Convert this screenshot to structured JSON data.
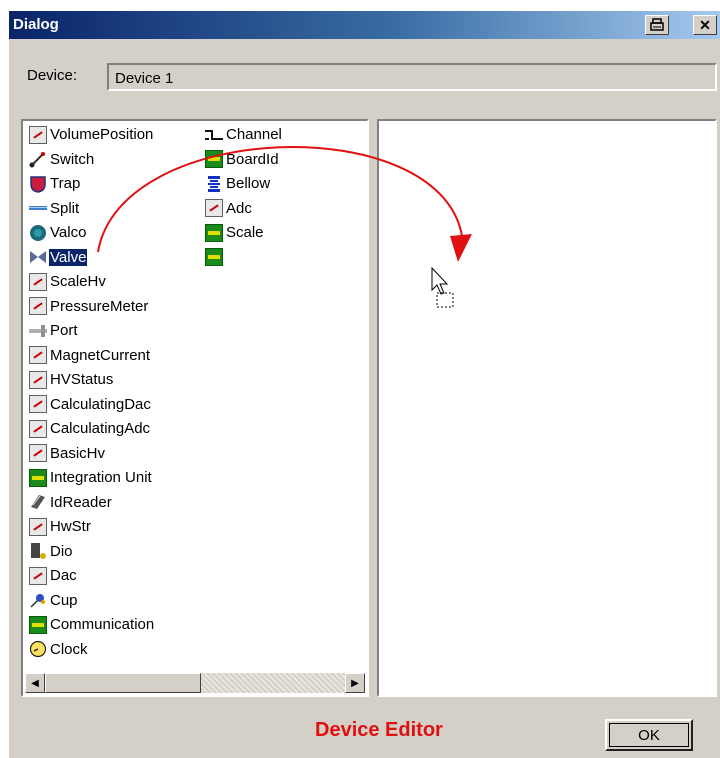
{
  "dialog": {
    "title": "Dialog",
    "device_label": "Device:",
    "device_value": "Device 1",
    "ok_label": "OK",
    "caption": "Device Editor"
  },
  "list": {
    "col1": [
      {
        "label": "VolumePosition",
        "icon": "gauge-icon"
      },
      {
        "label": "Switch",
        "icon": "switch-icon"
      },
      {
        "label": "Trap",
        "icon": "trap-icon"
      },
      {
        "label": "Split",
        "icon": "split-icon"
      },
      {
        "label": "Valco",
        "icon": "valco-icon"
      },
      {
        "label": "Valve",
        "icon": "valve-icon",
        "selected": true
      },
      {
        "label": "ScaleHv",
        "icon": "gauge-icon"
      },
      {
        "label": "PressureMeter",
        "icon": "gauge-icon"
      },
      {
        "label": "Port",
        "icon": "port-icon"
      },
      {
        "label": "MagnetCurrent",
        "icon": "gauge-icon"
      },
      {
        "label": "HVStatus",
        "icon": "gauge-icon"
      },
      {
        "label": "CalculatingDac",
        "icon": "gauge-icon"
      },
      {
        "label": "CalculatingAdc",
        "icon": "gauge-icon"
      },
      {
        "label": "BasicHv",
        "icon": "gauge-icon"
      },
      {
        "label": "Integration Unit",
        "icon": "board-icon"
      },
      {
        "label": "IdReader",
        "icon": "id-reader-icon"
      },
      {
        "label": "HwStr",
        "icon": "gauge-icon"
      },
      {
        "label": "Dio",
        "icon": "dio-icon"
      },
      {
        "label": "Dac",
        "icon": "gauge-icon"
      },
      {
        "label": "Cup",
        "icon": "cup-icon"
      },
      {
        "label": "Communication",
        "icon": "board-icon"
      },
      {
        "label": "Clock",
        "icon": "clock-icon"
      }
    ],
    "col2": [
      {
        "label": "Channel",
        "icon": "channel-icon"
      },
      {
        "label": "BoardId",
        "icon": "board-icon"
      },
      {
        "label": "Bellow",
        "icon": "bellow-icon"
      },
      {
        "label": "Adc",
        "icon": "gauge-icon"
      },
      {
        "label": "Scale",
        "icon": "board-icon"
      },
      {
        "label": "",
        "icon": "board-icon"
      }
    ]
  },
  "colors": {
    "title_gradient_start": "#0a246a",
    "title_gradient_end": "#a6caf0",
    "selection": "#0a246a",
    "annotation_red": "#e01010",
    "face": "#d4d0c8"
  }
}
